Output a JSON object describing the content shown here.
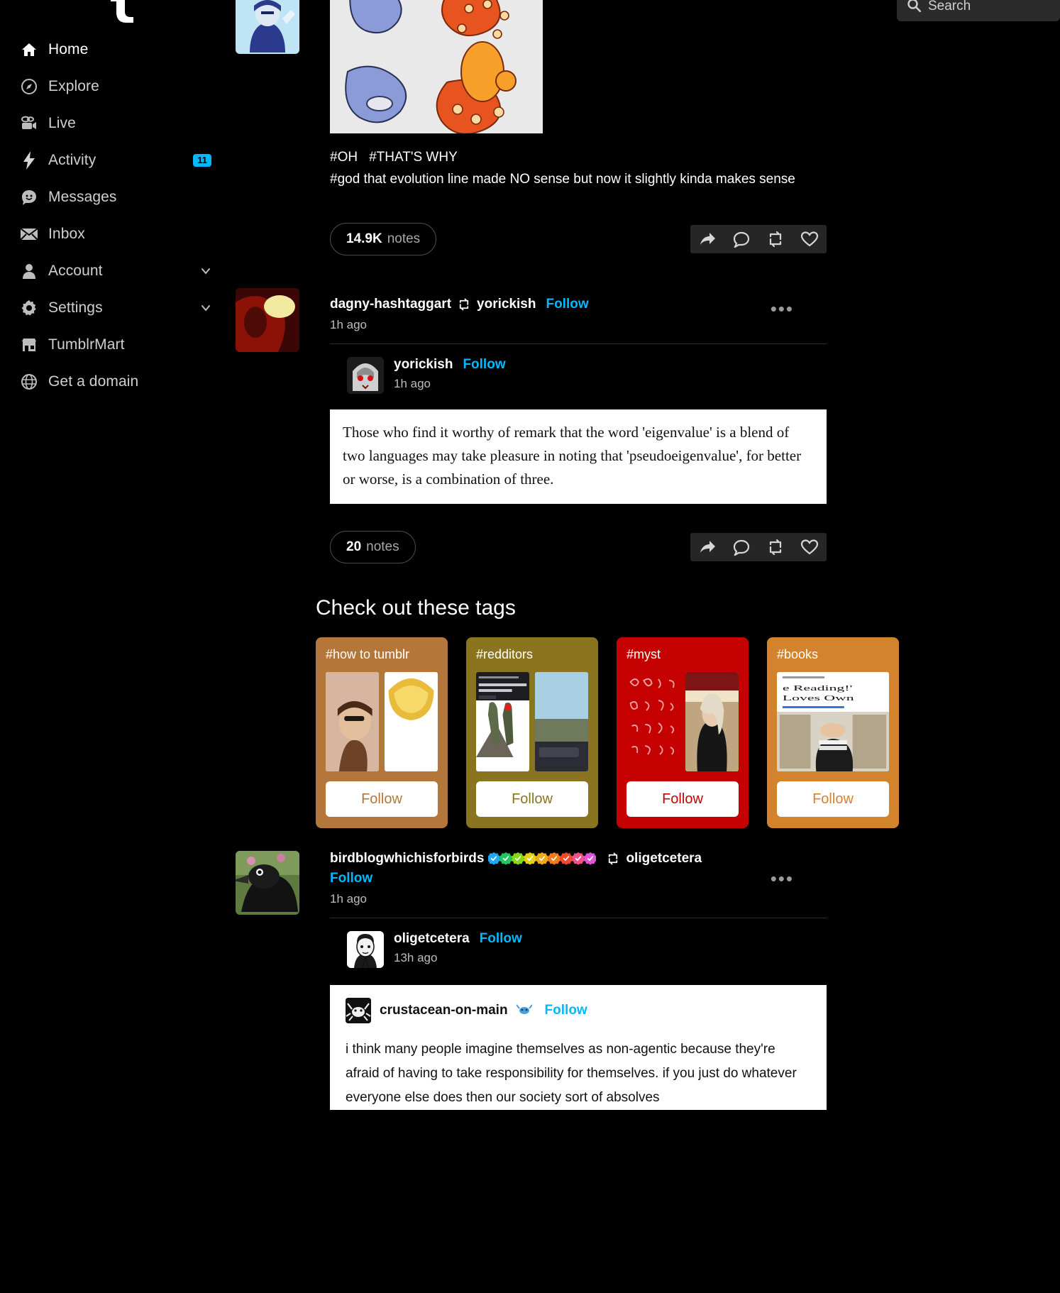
{
  "sidebar": {
    "logo_icon": "tumblr-logo",
    "items": [
      {
        "label": "Home",
        "icon": "home-icon",
        "badge": null,
        "chevron": false
      },
      {
        "label": "Explore",
        "icon": "compass-icon",
        "badge": null,
        "chevron": false
      },
      {
        "label": "Live",
        "icon": "video-camera-icon",
        "badge": null,
        "chevron": false
      },
      {
        "label": "Activity",
        "icon": "lightning-bolt-icon",
        "badge": "11",
        "chevron": false
      },
      {
        "label": "Messages",
        "icon": "chat-smiley-icon",
        "badge": null,
        "chevron": false
      },
      {
        "label": "Inbox",
        "icon": "envelope-icon",
        "badge": null,
        "chevron": false
      },
      {
        "label": "Account",
        "icon": "person-icon",
        "badge": null,
        "chevron": true
      },
      {
        "label": "Settings",
        "icon": "gear-icon",
        "badge": null,
        "chevron": true
      },
      {
        "label": "TumblrMart",
        "icon": "storefront-icon",
        "badge": null,
        "chevron": false
      },
      {
        "label": "Get a domain",
        "icon": "globe-icon",
        "badge": null,
        "chevron": false
      }
    ]
  },
  "search": {
    "placeholder": "Search",
    "icon": "search-icon"
  },
  "posts": [
    {
      "id": "post-pokemon",
      "tags_line1": "#OH",
      "tags_line1b": "#THAT'S WHY",
      "tags_line2": "#god that evolution line made NO sense but now it slightly kinda makes sense",
      "notes_count": "14.9K",
      "notes_label": "notes",
      "actions": [
        "share-icon",
        "reply-icon",
        "reblog-icon",
        "like-icon"
      ]
    },
    {
      "id": "post-eigenvalue",
      "reblogger": "dagny-hashtaggart",
      "reblog_source": "yorickish",
      "follow_label": "Follow",
      "time": "1h ago",
      "inner_user": "yorickish",
      "inner_follow": "Follow",
      "inner_time": "1h ago",
      "quote_text": "Those who find it worthy of remark that the word 'eigenvalue' is a blend of two languages may take pleasure in noting that 'pseudoeigenvalue', for better or worse, is a combination of three.",
      "notes_count": "20",
      "notes_label": "notes",
      "actions": [
        "share-icon",
        "reply-icon",
        "reblog-icon",
        "like-icon"
      ]
    },
    {
      "id": "post-birdblog",
      "reblogger": "birdblogwhichisforbirds",
      "reblog_source": "oligetcetera",
      "follow_label": "Follow",
      "time": "1h ago",
      "inner_user": "oligetcetera",
      "inner_follow": "Follow",
      "inner_time": "13h ago",
      "white_user": "crustacean-on-main",
      "white_follow": "Follow",
      "white_body": "i think many people imagine themselves as non-agentic because they're afraid of having to take responsibility for themselves. if you just do whatever everyone else does then our society sort of absolves"
    }
  ],
  "tags_section": {
    "title": "Check out these tags",
    "cards": [
      {
        "name": "#how to tumblr",
        "bg": "#b5763a",
        "follow_label": "Follow",
        "follow_color": "#b5763a"
      },
      {
        "name": "#redditors",
        "bg": "#8a7420",
        "follow_label": "Follow",
        "follow_color": "#8a7420"
      },
      {
        "name": "#myst",
        "bg": "#c40000",
        "follow_label": "Follow",
        "follow_color": "#c40000"
      },
      {
        "name": "#books",
        "bg": "#d2832c",
        "follow_label": "Follow",
        "follow_color": "#d2832c"
      }
    ]
  },
  "colors": {
    "accent_blue": "#00b8ff",
    "background": "#000000",
    "text_primary": "#ffffff",
    "text_secondary": "#a8a8a8"
  },
  "verified_badge_colors": [
    "#1ea7f2",
    "#22c55e",
    "#86d916",
    "#e3d019",
    "#f0a818",
    "#f47a1a",
    "#ef4a2a",
    "#f2508b",
    "#e254d6"
  ]
}
